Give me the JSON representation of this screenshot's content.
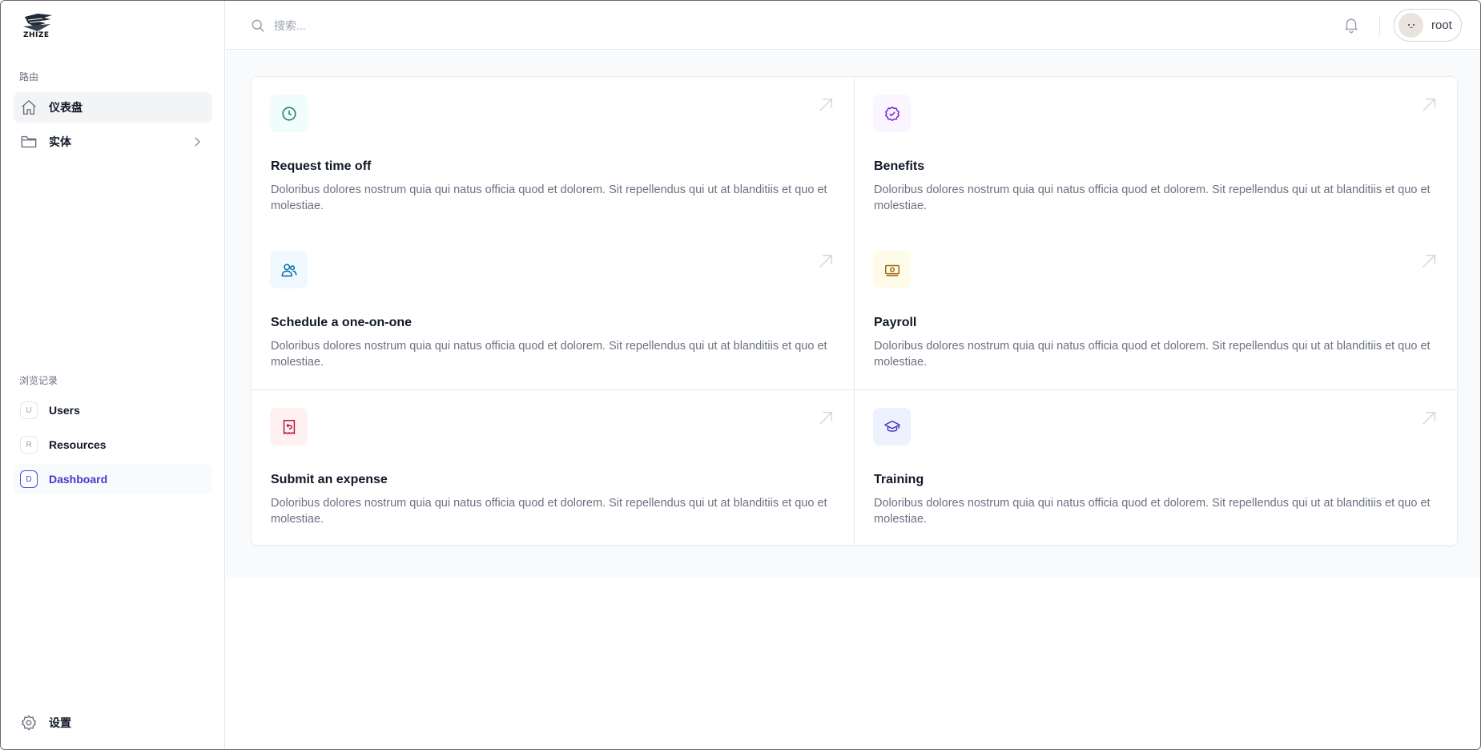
{
  "brand": {
    "logo_text": "ZHIZE"
  },
  "sidebar": {
    "routes_label": "路由",
    "routes": [
      {
        "label": "仪表盘",
        "icon": "home-icon",
        "active": true
      },
      {
        "label": "实体",
        "icon": "folder-icon",
        "has_children": true
      }
    ],
    "history_label": "浏览记录",
    "history": [
      {
        "badge": "U",
        "label": "Users"
      },
      {
        "badge": "R",
        "label": "Resources"
      },
      {
        "badge": "D",
        "label": "Dashboard",
        "current": true
      }
    ],
    "settings_label": "设置"
  },
  "topbar": {
    "search_placeholder": "搜索...",
    "user_name": "root"
  },
  "cards": [
    {
      "title": "Request time off",
      "desc": "Doloribus dolores nostrum quia qui natus officia quod et dolorem. Sit repellendus qui ut at blanditiis et quo et molestiae.",
      "icon": "clock-icon",
      "tile_bg": "#f0fdfa",
      "icon_color": "#0f766e"
    },
    {
      "title": "Benefits",
      "desc": "Doloribus dolores nostrum quia qui natus officia quod et dolorem. Sit repellendus qui ut at blanditiis et quo et molestiae.",
      "icon": "check-badge-icon",
      "tile_bg": "#faf5ff",
      "icon_color": "#7e22ce"
    },
    {
      "title": "Schedule a one-on-one",
      "desc": "Doloribus dolores nostrum quia qui natus officia quod et dolorem. Sit repellendus qui ut at blanditiis et quo et molestiae.",
      "icon": "users-icon",
      "tile_bg": "#f0f9ff",
      "icon_color": "#0369a1"
    },
    {
      "title": "Payroll",
      "desc": "Doloribus dolores nostrum quia qui natus officia quod et dolorem. Sit repellendus qui ut at blanditiis et quo et molestiae.",
      "icon": "banknotes-icon",
      "tile_bg": "#fefce8",
      "icon_color": "#a16207"
    },
    {
      "title": "Submit an expense",
      "desc": "Doloribus dolores nostrum quia qui natus officia quod et dolorem. Sit repellendus qui ut at blanditiis et quo et molestiae.",
      "icon": "receipt-refund-icon",
      "tile_bg": "#fff1f2",
      "icon_color": "#be123c"
    },
    {
      "title": "Training",
      "desc": "Doloribus dolores nostrum quia qui natus officia quod et dolorem. Sit repellendus qui ut at blanditiis et quo et molestiae.",
      "icon": "academic-cap-icon",
      "tile_bg": "#eef2ff",
      "icon_color": "#4338ca"
    }
  ]
}
